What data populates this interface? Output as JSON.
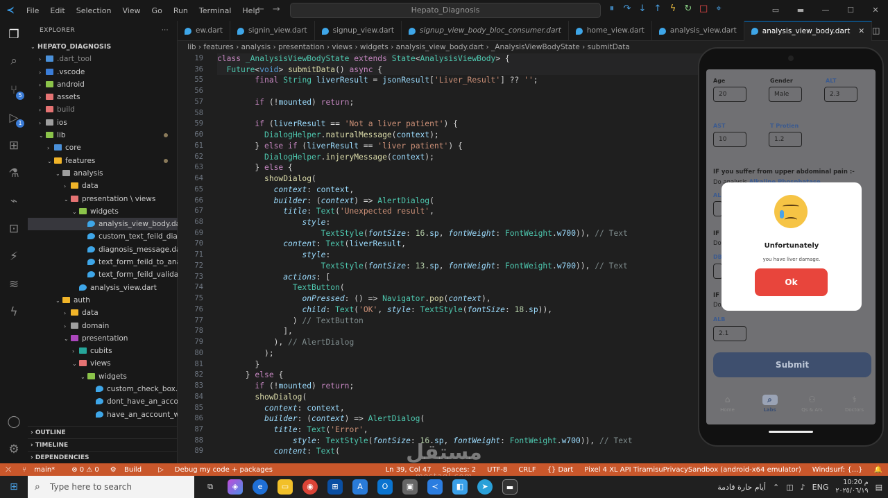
{
  "titlebar": {
    "menu": [
      "File",
      "Edit",
      "Selection",
      "View",
      "Go",
      "Run",
      "Terminal",
      "Help"
    ],
    "search": "Hepato_Diagnosis"
  },
  "explorer": {
    "title": "EXPLORER",
    "project": "HEPATO_DIAGNOSIS"
  },
  "tree": [
    {
      "label": "HEPATO_DIAGNOSIS",
      "depth": 0,
      "chev": "v",
      "bold": true,
      "color": ""
    },
    {
      "label": ".dart_tool",
      "depth": 1,
      "chev": ">",
      "color": "#4a90d9",
      "dim": true
    },
    {
      "label": ".vscode",
      "depth": 1,
      "chev": ">",
      "color": "#3b7dd8"
    },
    {
      "label": "android",
      "depth": 1,
      "chev": ">",
      "color": "#8bc34a"
    },
    {
      "label": "assets",
      "depth": 1,
      "chev": ">",
      "color": "#e57373"
    },
    {
      "label": "build",
      "depth": 1,
      "chev": ">",
      "color": "#e57373",
      "dim": true
    },
    {
      "label": "ios",
      "depth": 1,
      "chev": ">",
      "color": "#9e9e9e"
    },
    {
      "label": "lib",
      "depth": 1,
      "chev": "v",
      "color": "#8bc34a",
      "dot": true
    },
    {
      "label": "core",
      "depth": 2,
      "chev": ">",
      "color": "#4a90d9"
    },
    {
      "label": "features",
      "depth": 2,
      "chev": "v",
      "color": "#f0b429",
      "dot": true
    },
    {
      "label": "analysis",
      "depth": 3,
      "chev": "v",
      "color": "#9e9e9e"
    },
    {
      "label": "data",
      "depth": 4,
      "chev": ">",
      "color": "#f0b429"
    },
    {
      "label": "presentation \\ views",
      "depth": 4,
      "chev": "v",
      "color": "#e57373"
    },
    {
      "label": "widgets",
      "depth": 5,
      "chev": "v",
      "color": "#8bc34a"
    },
    {
      "label": "analysis_view_body.dart",
      "depth": 6,
      "chev": "",
      "color": "#3ea6e8",
      "sel": true
    },
    {
      "label": "custom_text_feild_diagnosi...",
      "depth": 6,
      "chev": "",
      "color": "#3ea6e8"
    },
    {
      "label": "diagnosis_message.dart",
      "depth": 6,
      "chev": "",
      "color": "#3ea6e8"
    },
    {
      "label": "text_form_feild_to_analysis...",
      "depth": 6,
      "chev": "",
      "color": "#3ea6e8"
    },
    {
      "label": "text_form_feild_validator.d...",
      "depth": 6,
      "chev": "",
      "color": "#3ea6e8"
    },
    {
      "label": "analysis_view.dart",
      "depth": 5,
      "chev": "",
      "color": "#3ea6e8"
    },
    {
      "label": "auth",
      "depth": 3,
      "chev": "v",
      "color": "#f0b429"
    },
    {
      "label": "data",
      "depth": 4,
      "chev": ">",
      "color": "#f0b429"
    },
    {
      "label": "domain",
      "depth": 4,
      "chev": ">",
      "color": "#9e9e9e"
    },
    {
      "label": "presentation",
      "depth": 4,
      "chev": "v",
      "color": "#ab47bc"
    },
    {
      "label": "cubits",
      "depth": 5,
      "chev": ">",
      "color": "#26a69a"
    },
    {
      "label": "views",
      "depth": 5,
      "chev": "v",
      "color": "#e57373"
    },
    {
      "label": "widgets",
      "depth": 6,
      "chev": "v",
      "color": "#8bc34a"
    },
    {
      "label": "custom_check_box.dart",
      "depth": 7,
      "chev": "",
      "color": "#3ea6e8"
    },
    {
      "label": "dont_have_an_account_w...",
      "depth": 7,
      "chev": "",
      "color": "#3ea6e8"
    },
    {
      "label": "have_an_account_widget...",
      "depth": 7,
      "chev": "",
      "color": "#3ea6e8"
    }
  ],
  "sidebar_bottom": [
    "OUTLINE",
    "TIMELINE",
    "DEPENDENCIES"
  ],
  "tabs": [
    {
      "label": "ew.dart",
      "active": false
    },
    {
      "label": "signin_view.dart",
      "active": false
    },
    {
      "label": "signup_view.dart",
      "active": false
    },
    {
      "label": "signup_view_body_bloc_consumer.dart",
      "active": false,
      "italic": true
    },
    {
      "label": "home_view.dart",
      "active": false
    },
    {
      "label": "analysis_view.dart",
      "active": false
    },
    {
      "label": "analysis_view_body.dart",
      "active": true
    }
  ],
  "breadcrumb": "lib › features › analysis › presentation › views › widgets › analysis_view_body.dart › _AnalysisViewBodyState › submitData",
  "line_numbers": [
    "19",
    "36",
    "55",
    "56",
    "57",
    "58",
    "59",
    "60",
    "61",
    "62",
    "63",
    "64",
    "65",
    "66",
    "67",
    "68",
    "69",
    "70",
    "71",
    "72",
    "73",
    "74",
    "75",
    "76",
    "77",
    "78",
    "79",
    "80",
    "81",
    "82",
    "83",
    "84",
    "85",
    "86",
    "87",
    "88",
    "89"
  ],
  "code": [
    "<span class='kw'>class</span> <span class='ty'>_AnalysisViewBodyState</span> <span class='kw'>extends</span> <span class='ty'>State</span>&lt;<span class='ty'>AnalysisViewBody</span>&gt; {",
    "  <span class='ty'>Future</span>&lt;<span class='bl'>void</span>&gt; <span class='fn'>submitData</span>() <span class='kw'>async</span> {",
    "        <span class='kw'>final</span> <span class='ty'>String</span> <span class='pr' style='font-style:normal'>liverResult</span> = <span class='pr' style='font-style:normal'>jsonResult</span>[<span class='st'>'Liver_Result'</span>] ?? <span class='st'>''</span>;",
    "",
    "        <span class='kw'>if</span> (!<span class='pr' style='font-style:normal'>mounted</span>) <span class='kw'>return</span>;",
    "",
    "        <span class='kw'>if</span> (<span class='pr' style='font-style:normal'>liverResult</span> == <span class='st'>'Not a liver patient'</span>) {",
    "          <span class='ty'>DialogHelper</span>.<span class='fn'>naturalMessage</span>(<span class='pr' style='font-style:normal'>context</span>);",
    "        } <span class='kw'>else if</span> (<span class='pr' style='font-style:normal'>liverResult</span> == <span class='st'>'liver patient'</span>) {",
    "          <span class='ty'>DialogHelper</span>.<span class='fn'>injeryMessage</span>(<span class='pr' style='font-style:normal'>context</span>);",
    "        } <span class='kw'>else</span> {",
    "          <span class='fn'>showDialog</span>(",
    "            <span class='pr'>context</span>: <span class='pr' style='font-style:normal'>context</span>,",
    "            <span class='pr'>builder</span>: (<span class='pr'>context</span>) =&gt; <span class='ty'>AlertDialog</span>(",
    "              <span class='pr'>title</span>: <span class='ty'>Text</span>(<span class='st'>'Unexpected result'</span>,",
    "                  <span class='pr'>style</span>:",
    "                      <span class='ty'>TextStyle</span>(<span class='pr'>fontSize</span>: <span class='nm'>16</span>.<span class='pr' style='font-style:normal'>sp</span>, <span class='pr'>fontWeight</span>: <span class='ty'>FontWeight</span>.<span class='pr' style='font-style:normal'>w700</span>)), <span class='cm'>// Text</span>",
    "              <span class='pr'>content</span>: <span class='ty'>Text</span>(<span class='pr' style='font-style:normal'>liverResult</span>,",
    "                  <span class='pr'>style</span>:",
    "                      <span class='ty'>TextStyle</span>(<span class='pr'>fontSize</span>: <span class='nm'>13</span>.<span class='pr' style='font-style:normal'>sp</span>, <span class='pr'>fontWeight</span>: <span class='ty'>FontWeight</span>.<span class='pr' style='font-style:normal'>w700</span>)), <span class='cm'>// Text</span>",
    "              <span class='pr'>actions</span>: [",
    "                <span class='ty'>TextButton</span>(",
    "                  <span class='pr'>onPressed</span>: () =&gt; <span class='ty'>Navigator</span>.<span class='fn'>pop</span>(<span class='pr'>context</span>),",
    "                  <span class='pr'>child</span>: <span class='ty'>Text</span>(<span class='st'>'OK'</span>, <span class='pr'>style</span>: <span class='ty'>TextStyle</span>(<span class='pr'>fontSize</span>: <span class='nm'>18</span>.<span class='pr' style='font-style:normal'>sp</span>)),",
    "                ) <span class='cm'>// TextButton</span>",
    "              ],",
    "            ), <span class='cm'>// AlertDialog</span>",
    "          );",
    "        }",
    "      } <span class='kw'>else</span> {",
    "        <span class='kw'>if</span> (!<span class='pr' style='font-style:normal'>mounted</span>) <span class='kw'>return</span>;",
    "        <span class='fn'>showDialog</span>(",
    "          <span class='pr'>context</span>: <span class='pr' style='font-style:normal'>context</span>,",
    "          <span class='pr'>builder</span>: (<span class='pr'>context</span>) =&gt; <span class='ty'>AlertDialog</span>(",
    "            <span class='pr'>title</span>: <span class='ty'>Text</span>(<span class='st'>'Error'</span>,",
    "                <span class='pr'>style</span>: <span class='ty'>TextStyle</span>(<span class='pr'>fontSize</span>: <span class='nm'>16</span>.<span class='pr' style='font-style:normal'>sp</span>, <span class='pr'>fontWeight</span>: <span class='ty'>FontWeight</span>.<span class='pr' style='font-style:normal'>w700</span>)), <span class='cm'>// Text</span>",
    "            <span class='pr'>content</span>: <span class='ty'>Text</span>("
  ],
  "phone": {
    "labels": {
      "age": "Age",
      "gender": "Gender",
      "alt": "ALT",
      "ast": "AST",
      "tprot": "T Protien",
      "alb": "ALB",
      "alb2": "ALB",
      "dbil": "DBI"
    },
    "values": {
      "age": "20",
      "gender": "Male",
      "alt": "2.3",
      "ast": "10",
      "tprot": "1.2",
      "alb": "2.1"
    },
    "pain_q": "IF you suffer from upper abdominal pain :-",
    "do_analysis": "Do analysis",
    "alk": "Alkaline Phosphatase",
    "if_short": "IF y",
    "do_short": "Do",
    "submit": "Submit",
    "nav": [
      "Home",
      "Labs",
      "Qs & Ars",
      "Doctors"
    ]
  },
  "dialog": {
    "title": "Unfortunately",
    "message": "you have liver damage.",
    "ok": "Ok"
  },
  "statusbar": {
    "branch": "main*",
    "errors": "⊗ 0 ⚠ 0",
    "build": "Build",
    "debug": "Debug my code + packages",
    "pos": "Ln 39, Col 47",
    "spaces": "Spaces: 2",
    "enc": "UTF-8",
    "eol": "CRLF",
    "lang": "{} Dart",
    "device": "Pixel 4 XL API TiramisuPrivacySandbox (android-x64 emulator)",
    "windsurf": "Windsurf: {...}"
  },
  "watermark": {
    "arabic": "مستقل",
    "latin": "mostaql.com"
  },
  "taskbar": {
    "search": "Type here to search",
    "weather": "أيام حارة قادمة",
    "lang": "ENG",
    "time": "10:20 م",
    "date": "٢٠٢٥/٠٦/١٩"
  }
}
